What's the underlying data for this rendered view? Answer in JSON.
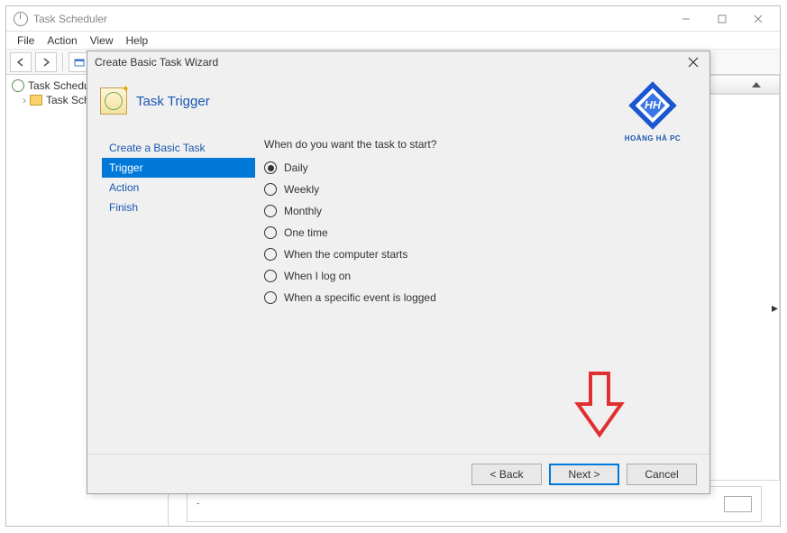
{
  "app": {
    "title": "Task Scheduler"
  },
  "menubar": {
    "items": [
      "File",
      "Action",
      "View",
      "Help"
    ]
  },
  "tree": {
    "root": "Task Scheduler (Local)",
    "child": "Task Scheduler Library"
  },
  "dialog": {
    "title": "Create Basic Task Wizard",
    "header_title": "Task Trigger",
    "logo_text": "HOÀNG HÀ PC",
    "nav": {
      "items": [
        "Create a Basic Task",
        "Trigger",
        "Action",
        "Finish"
      ],
      "selected_index": 1
    },
    "content": {
      "prompt": "When do you want the task to start?",
      "options": [
        "Daily",
        "Weekly",
        "Monthly",
        "One time",
        "When the computer starts",
        "When I log on",
        "When a specific event is logged"
      ],
      "selected_index": 0
    },
    "footer": {
      "back": "< Back",
      "next": "Next >",
      "cancel": "Cancel"
    }
  }
}
